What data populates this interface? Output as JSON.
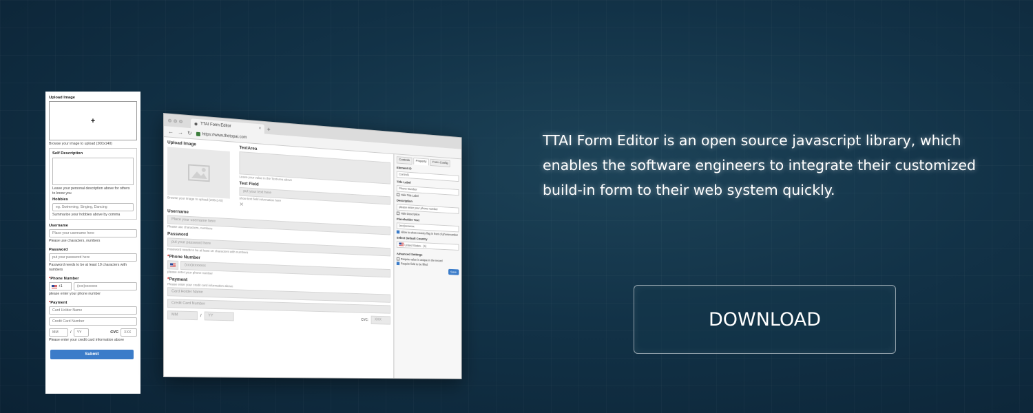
{
  "mobile_form": {
    "upload_label": "Upload Image",
    "upload_plus": "+",
    "upload_help": "Browse your image to upload (200x140)",
    "self_desc_label": "Self Description",
    "self_desc_help": "Leave your personal description above for others to know you",
    "hobbies_label": "Hobbies",
    "hobbies_placeholder": "eg. Swimming, Singing, Dancing",
    "hobbies_help": "Summarize your hobbies above by comma",
    "username_label": "Username",
    "username_placeholder": "Place your username here",
    "username_help": "Please use characters, numbers",
    "password_label": "Password",
    "password_placeholder": "put your password here",
    "password_help": "Password needs to be at least 10 characters with numbers",
    "phone_label": "Phone Number",
    "phone_code": "+1",
    "phone_placeholder": "(xxx)xxxxxxx",
    "phone_help": "please enter your phone number",
    "payment_label": "Payment",
    "card_holder_placeholder": "Card Holder Name",
    "card_number_placeholder": "Credit Card Number",
    "mm_placeholder": "MM",
    "slash": "/",
    "yy_placeholder": "YY",
    "cvc_label": "CVC",
    "cvc_placeholder": "XXX",
    "payment_help": "Please enter your credit card information above",
    "submit_label": "Submit"
  },
  "browser": {
    "tab_title": "TTAI Form Editor",
    "tab_close": "×",
    "new_tab": "+",
    "url": "https://www.thetopai.com",
    "canvas": {
      "upload_label": "Upload Image",
      "upload_help": "Browse your image to upload (200x140)",
      "textarea_label": "TextArea",
      "textarea_help": "Leave your value in the TextArea above",
      "textfield_label": "Text Field",
      "textfield_placeholder": "put your text here",
      "textfield_help": "show text field information here",
      "username_label": "Username",
      "username_placeholder": "Place your username here",
      "username_help": "Please use characters, numbers",
      "password_label": "Password",
      "password_placeholder": "put your password here",
      "password_help": "Password needs to be at least 10 characters with numbers",
      "phone_label": "Phone Number",
      "phone_placeholder": "(xxx)xxxxxxx",
      "phone_help": "please enter your phone number",
      "payment_label": "Payment",
      "payment_help": "Please enter your credit card information above",
      "card_holder_placeholder": "Card Holder Name",
      "card_number_placeholder": "Credit Card Number",
      "cvc_label": "CVC:",
      "cvc_placeholder": "XXX",
      "mm_placeholder": "MM",
      "yy_placeholder": "YY"
    },
    "sidebar": {
      "tabs": [
        "Controls",
        "Property",
        "Form Config"
      ],
      "element_id_label": "Element ID",
      "element_id_value": "Control1",
      "title_label": "Title Label",
      "title_value": "Phone Number",
      "hide_title": "Hide Title Label",
      "description_label": "Description",
      "description_value": "please enter your phone number",
      "hide_description": "Hide Description",
      "placeholder_label": "Placeholder Text",
      "placeholder_value": "(xxx)xxxxxxx",
      "allow_flag": "Allow to show country flag in front of phonenumber",
      "default_country_label": "Select Default Country",
      "default_country_value": "United States - (1)",
      "advanced_label": "Advanced Settings",
      "require_unique": "Require value is unique in the record",
      "require_filled": "Require field to be filled",
      "save_label": "Save"
    }
  },
  "tagline": "TTAI Form Editor is an open source javascript library, which enables the software engineers to integrate their customized build-in form to their web system quickly.",
  "download_label": "DOWNLOAD"
}
